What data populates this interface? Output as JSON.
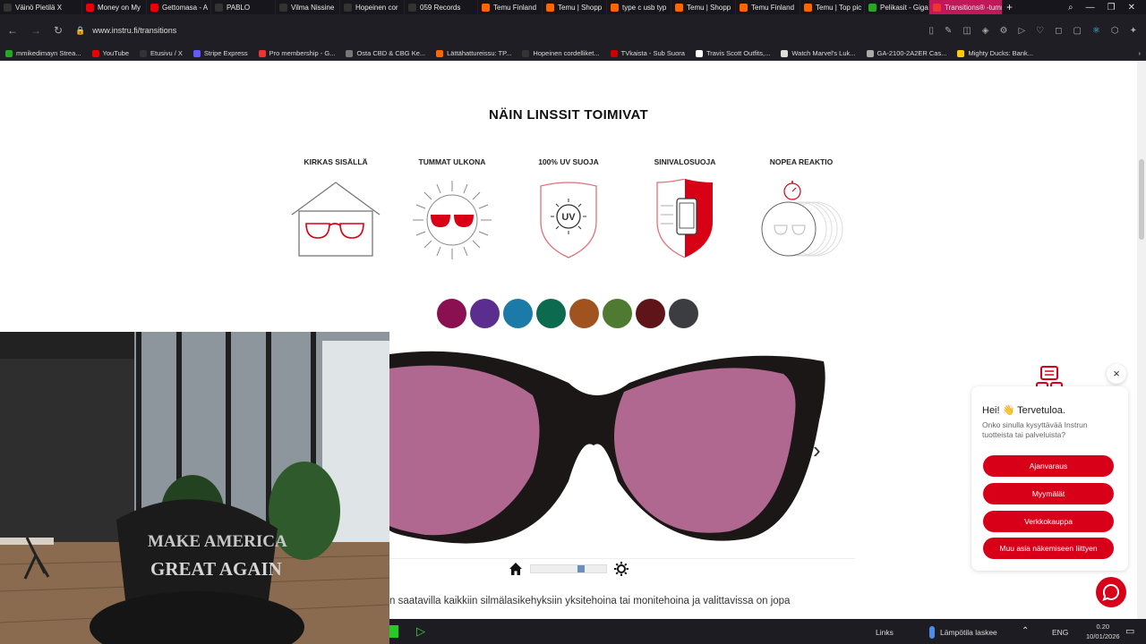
{
  "tabs": [
    {
      "label": "Väinö Pietilä X",
      "color": "#333"
    },
    {
      "label": "Money on My",
      "color": "#e00"
    },
    {
      "label": "Gettomasa - A",
      "color": "#e00"
    },
    {
      "label": "PABLO",
      "color": "#333"
    },
    {
      "label": "Vilma Nissine",
      "color": "#333"
    },
    {
      "label": "Hopeinen cor",
      "color": "#333"
    },
    {
      "label": "059 Records",
      "color": "#333"
    },
    {
      "label": "Temu Finland",
      "color": "#f60"
    },
    {
      "label": "Temu | Shopp",
      "color": "#f60"
    },
    {
      "label": "type c usb typ",
      "color": "#f60"
    },
    {
      "label": "Temu | Shopp",
      "color": "#f60"
    },
    {
      "label": "Temu Finland",
      "color": "#f60"
    },
    {
      "label": "Temu | Top pic",
      "color": "#f60"
    },
    {
      "label": "Pelikasit - Giga",
      "color": "#2a2"
    },
    {
      "label": "Transitions® -tumma",
      "color": "#e33",
      "active": true
    }
  ],
  "address": {
    "url": "www.instru.fi/transitions"
  },
  "bookmarks": [
    {
      "label": "mmikedimayn Strea...",
      "color": "#2a2"
    },
    {
      "label": "YouTube",
      "color": "#e00"
    },
    {
      "label": "Etusivu / X",
      "color": "#333"
    },
    {
      "label": "Stripe Express",
      "color": "#635bff"
    },
    {
      "label": "Pro membership - G...",
      "color": "#e33"
    },
    {
      "label": "Osta CBD & CBG Ke...",
      "color": "#777"
    },
    {
      "label": "Lättähattureissu: TP...",
      "color": "#f60"
    },
    {
      "label": "Hopeinen cordelliket...",
      "color": "#333"
    },
    {
      "label": "TVkaista - Sub Suora",
      "color": "#c00"
    },
    {
      "label": "Travis Scott Outfits,...",
      "color": "#fff"
    },
    {
      "label": "Watch Marvel's Luk...",
      "color": "#ddd"
    },
    {
      "label": "GA-2100-2A2ER Cas...",
      "color": "#aaa"
    },
    {
      "label": "Mighty Ducks: Bank...",
      "color": "#fc0"
    }
  ],
  "page": {
    "heading": "NÄIN LINSSIT TOIMIVAT",
    "features": [
      {
        "label": "KIRKAS SISÄLLÄ",
        "icon": "house-glasses-icon"
      },
      {
        "label": "TUMMAT ULKONA",
        "icon": "sun-glasses-icon"
      },
      {
        "label": "100% UV SUOJA",
        "icon": "uv-shield-icon"
      },
      {
        "label": "SINIVALOSUOJA",
        "icon": "phone-shield-icon"
      },
      {
        "label": "NOPEA REAKTIO",
        "icon": "stopwatch-glasses-icon"
      }
    ],
    "swatches": [
      "#8b1052",
      "#5b2d8e",
      "#1b7aa8",
      "#0c6b4e",
      "#a0531f",
      "#4e7a31",
      "#5e1418",
      "#3c3d40"
    ],
    "lens_color": "#b06890",
    "body_text": "n saatavilla kaikkiin silmälasikehyksiin yksitehoina tai monitehoina ja valittavissa on jopa"
  },
  "chat": {
    "greeting": "Hei! 👋 Tervetuloa.",
    "question": "Onko sinulla kysyttävää Instrun tuotteista tai palveluista?",
    "buttons": [
      "Ajanvaraus",
      "Myymälät",
      "Verkkokauppa",
      "Muu asia näkemiseen liittyen"
    ]
  },
  "webcam": {
    "cap_text_1": "MAKE AMERICA",
    "cap_text_2": "GREAT AGAIN"
  },
  "taskbar": {
    "links": "Links",
    "weather": "Lämpötila laskee",
    "lang": "ENG",
    "time": "0.20",
    "date": "10/01/2026"
  }
}
